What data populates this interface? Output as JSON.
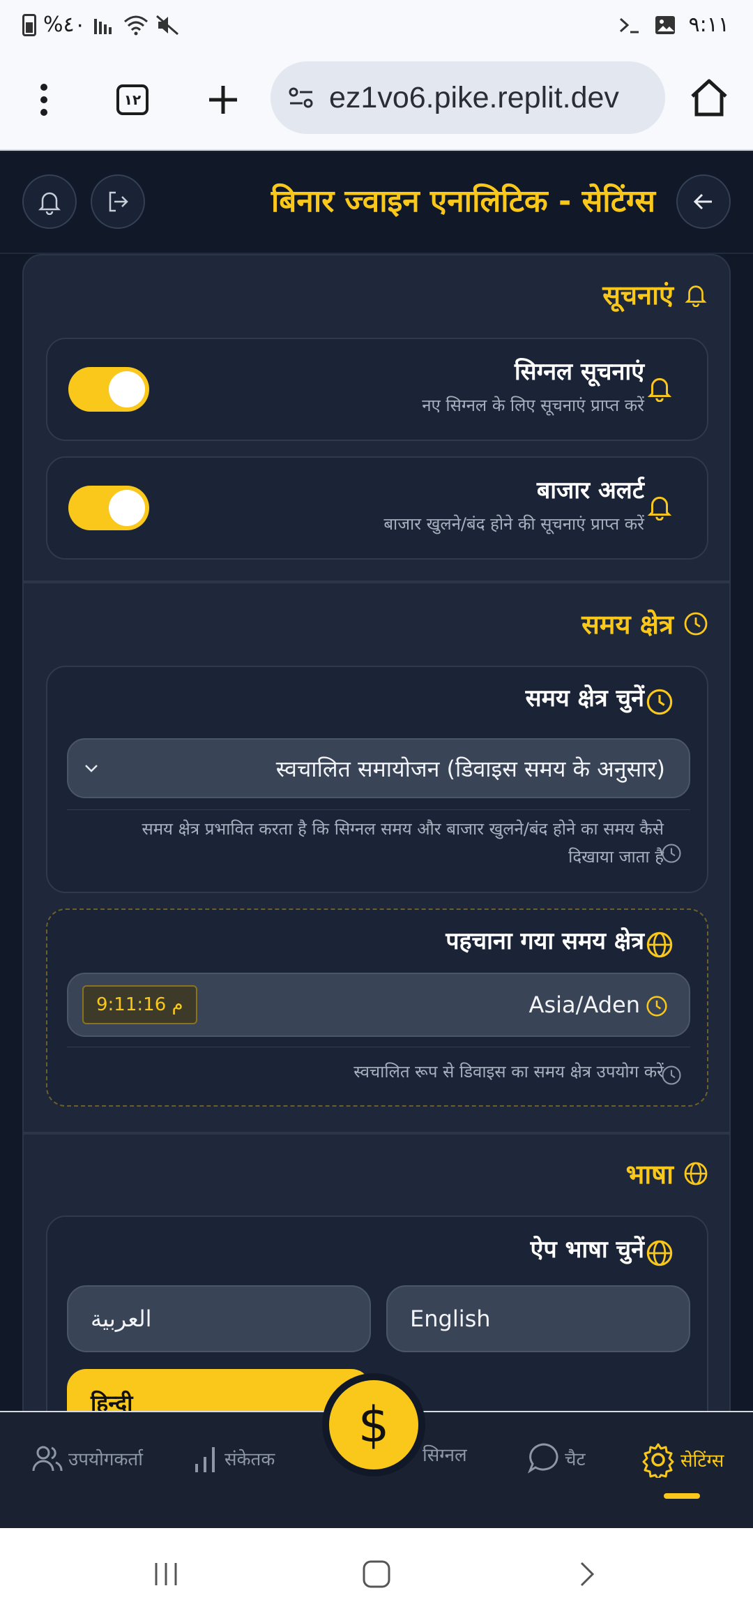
{
  "status_bar": {
    "battery_text": "%٤٠",
    "time": "٩:١١"
  },
  "browser": {
    "tab_count": "١٢",
    "url": "ez1vo6.pike.replit.dev"
  },
  "header": {
    "title": "बिनार ज्वाइन एनालिटिक - सेटिंग्स"
  },
  "notifications": {
    "section_title": "सूचनाएं",
    "items": [
      {
        "title": "सिग्नल सूचनाएं",
        "subtitle": "नए सिग्नल के लिए सूचनाएं प्राप्त करें",
        "enabled": true
      },
      {
        "title": "बाजार अलर्ट",
        "subtitle": "बाजार खुलने/बंद होने की सूचनाएं प्राप्त करें",
        "enabled": true
      }
    ]
  },
  "timezone": {
    "section_title": "समय क्षेत्र",
    "select_title": "समय क्षेत्र चुनें",
    "selected_value": "स्वचालित समायोजन (डिवाइस समय के अनुसार)",
    "note_line1": "समय क्षेत्र प्रभावित करता है कि सिग्नल समय और बाजार खुलने/बंद होने का समय कैसे",
    "note_line2": "दिखाया जाता है",
    "detected_title": "पहचाना गया समय क्षेत्र",
    "detected_zone": "Asia/Aden",
    "detected_time": "9:11:16 م",
    "detected_note": "स्वचालित रूप से डिवाइस का समय क्षेत्र उपयोग करें"
  },
  "language": {
    "section_title": "भाषा",
    "select_title": "ऐप भाषा चुनें",
    "options": [
      "العربية",
      "English",
      "हिन्दी"
    ],
    "selected": "हिन्दी"
  },
  "bottom_nav": {
    "items": [
      {
        "label": "उपयोगकर्ता",
        "icon": "users-icon"
      },
      {
        "label": "संकेतक",
        "icon": "bars-icon"
      },
      {
        "label": "सिग्नल",
        "icon": "dollar-icon"
      },
      {
        "label": "चैट",
        "icon": "chat-icon"
      },
      {
        "label": "सेटिंग्स",
        "icon": "gear-icon"
      }
    ],
    "fab_symbol": "$"
  },
  "colors": {
    "accent": "#f9c81b",
    "background": "#111827",
    "panel": "#1e283a"
  }
}
